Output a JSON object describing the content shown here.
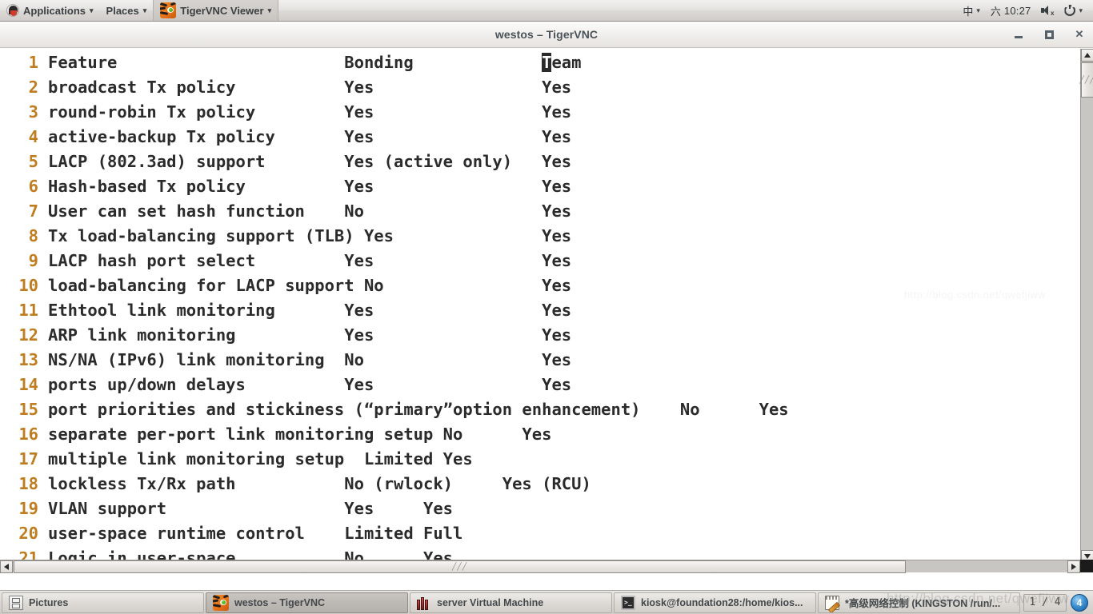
{
  "top_panel": {
    "logo_icon": "fedora-logo-icon",
    "menus": [
      {
        "label": "Applications",
        "icon": "fedora-logo-icon",
        "caret": "▾"
      },
      {
        "label": "Places",
        "icon": null,
        "caret": "▾"
      },
      {
        "label": "TigerVNC Viewer",
        "icon": "tiger-icon",
        "caret": "▾",
        "active": true
      }
    ],
    "tray": {
      "input_method": "中",
      "input_method_caret": "▾",
      "day": "六",
      "clock": "10:27",
      "volume_icon": "speaker-muted-icon",
      "power_icon": "power-icon",
      "power_caret": "▾"
    }
  },
  "window": {
    "title": "westos – TigerVNC",
    "minimize_label": "–",
    "maximize_label": "□",
    "close_label": "✕"
  },
  "editor": {
    "cursor_char": "T",
    "line_number_color": "#bf7d1f",
    "text_color": "#2b2b2b",
    "lines": [
      {
        "n": "1",
        "text": "Feature                       Bonding             ",
        "cursor": true,
        "after": "eam"
      },
      {
        "n": "2",
        "text": "broadcast Tx policy           Yes                 Yes"
      },
      {
        "n": "3",
        "text": "round-robin Tx policy         Yes                 Yes"
      },
      {
        "n": "4",
        "text": "active-backup Tx policy       Yes                 Yes"
      },
      {
        "n": "5",
        "text": "LACP (802.3ad) support        Yes (active only)   Yes"
      },
      {
        "n": "6",
        "text": "Hash-based Tx policy          Yes                 Yes"
      },
      {
        "n": "7",
        "text": "User can set hash function    No                  Yes"
      },
      {
        "n": "8",
        "text": "Tx load-balancing support (TLB) Yes               Yes"
      },
      {
        "n": "9",
        "text": "LACP hash port select         Yes                 Yes"
      },
      {
        "n": "10",
        "text": "load-balancing for LACP support No                Yes"
      },
      {
        "n": "11",
        "text": "Ethtool link monitoring       Yes                 Yes"
      },
      {
        "n": "12",
        "text": "ARP link monitoring           Yes                 Yes"
      },
      {
        "n": "13",
        "text": "NS/NA (IPv6) link monitoring  No                  Yes"
      },
      {
        "n": "14",
        "text": "ports up/down delays          Yes                 Yes"
      },
      {
        "n": "15",
        "text": "port priorities and stickiness (“primary”option enhancement)    No      Yes"
      },
      {
        "n": "16",
        "text": "separate per-port link monitoring setup No      Yes"
      },
      {
        "n": "17",
        "text": "multiple link monitoring setup  Limited Yes"
      },
      {
        "n": "18",
        "text": "lockless Tx/Rx path           No (rwlock)     Yes (RCU)"
      },
      {
        "n": "19",
        "text": "VLAN support                  Yes     Yes"
      },
      {
        "n": "20",
        "text": "user-space runtime control    Limited Full"
      },
      {
        "n": "21",
        "text": "Logic in user-space           No      Yes"
      }
    ]
  },
  "scrollbars": {
    "v_up_icon": "scroll-up-arrow-icon",
    "v_down_icon": "scroll-down-arrow-icon",
    "h_left_icon": "scroll-left-arrow-icon",
    "h_right_icon": "scroll-right-arrow-icon",
    "grip": "╱╱╱"
  },
  "taskbar": {
    "items": [
      {
        "label": "Pictures",
        "icon": "file-manager-icon",
        "active": false
      },
      {
        "label": "westos – TigerVNC",
        "icon": "tiger-icon",
        "active": true
      },
      {
        "label": "server Virtual Machine",
        "icon": "virtual-machine-icon",
        "active": false
      },
      {
        "label": "kiosk@foundation28:/home/kios...",
        "icon": "terminal-icon",
        "active": false
      },
      {
        "label": "*高级网络控制 (KINGSTON /run/...",
        "icon": "text-editor-icon",
        "active": false
      }
    ],
    "workspace_indicator": "1 / 4",
    "workspace_badge": "4"
  },
  "watermark": {
    "main": "http://blog.csdn.net/qwefjiww",
    "faint": "http://blog.csdn.net/qwefjiww"
  }
}
